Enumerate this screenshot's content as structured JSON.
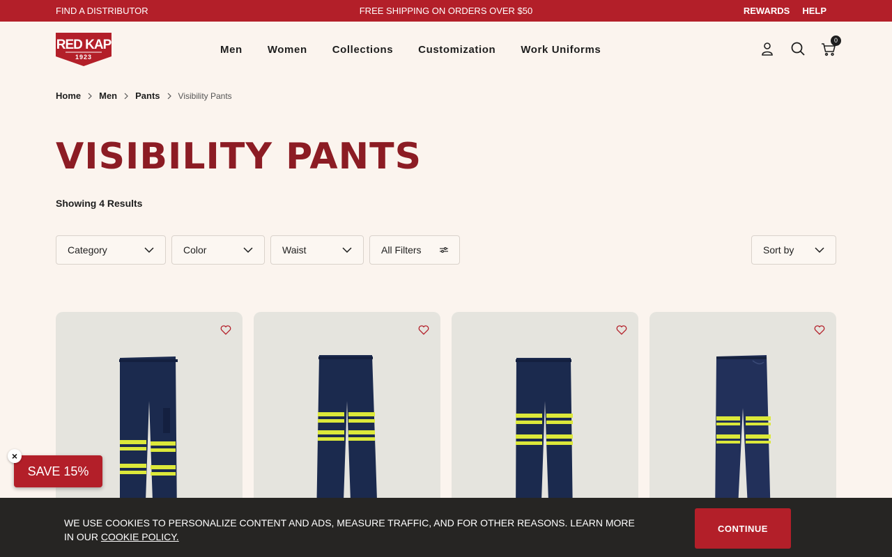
{
  "topbar": {
    "distributor": "FIND A DISTRIBUTOR",
    "shipping": "FREE SHIPPING ON ORDERS OVER $50",
    "rewards": "REWARDS",
    "help": "HELP"
  },
  "logo": {
    "brand": "RED KAP",
    "year": "1923"
  },
  "nav": [
    {
      "label": "Men"
    },
    {
      "label": "Women"
    },
    {
      "label": "Collections"
    },
    {
      "label": "Customization"
    },
    {
      "label": "Work Uniforms"
    }
  ],
  "header": {
    "cart_count": "0"
  },
  "breadcrumb": {
    "home": "Home",
    "men": "Men",
    "pants": "Pants",
    "current": "Visibility Pants"
  },
  "page": {
    "title": "VISIBILITY PANTS",
    "results": "Showing 4 Results"
  },
  "filters": {
    "category": "Category",
    "color": "Color",
    "waist": "Waist",
    "all_filters": "All Filters",
    "sort_by": "Sort by"
  },
  "promo": {
    "save": "SAVE 15%",
    "close": "×"
  },
  "cookie": {
    "text": "WE USE COOKIES TO PERSONALIZE CONTENT AND ADS, MEASURE TRAFFIC, AND FOR OTHER REASONS. LEARN MORE IN OUR ",
    "link": "COOKIE POLICY.",
    "button": "CONTINUE"
  },
  "colors": {
    "brand_red": "#b31f29",
    "title_red": "#8c1c24",
    "page_bg": "#fbf4ee",
    "card_bg": "#e5e4de",
    "pant_navy": "#1b2a4e",
    "reflective_stripe": "#dce83a",
    "cookie_bg": "#262523"
  }
}
